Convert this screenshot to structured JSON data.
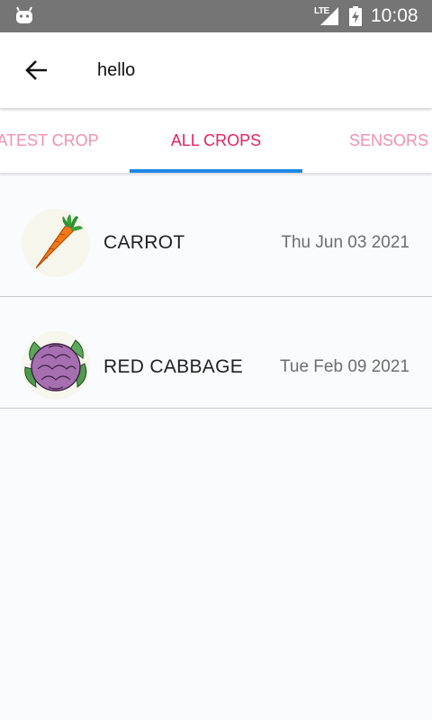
{
  "status_bar": {
    "network_label": "LTE",
    "time": "10:08",
    "icons": [
      "android-icon",
      "signal-icon",
      "battery-charging-icon"
    ]
  },
  "toolbar": {
    "back_icon": "arrow-left-icon",
    "title": "hello"
  },
  "tabs": [
    {
      "label": "LATEST CROP",
      "selected": false
    },
    {
      "label": "ALL CROPS",
      "selected": true
    },
    {
      "label": "SENSORS",
      "selected": false
    }
  ],
  "crops": [
    {
      "name": "CARROT",
      "date": "Thu Jun 03 2021",
      "image": "carrot-image"
    },
    {
      "name": "RED CABBAGE",
      "date": "Tue Feb 09 2021",
      "image": "red-cabbage-image"
    }
  ],
  "colors": {
    "status_bar": "#757575",
    "tab_selected": "#e91e63",
    "tab_unselected": "#f48fb1",
    "tab_indicator": "#1e88e5",
    "background": "#fafbfe"
  }
}
